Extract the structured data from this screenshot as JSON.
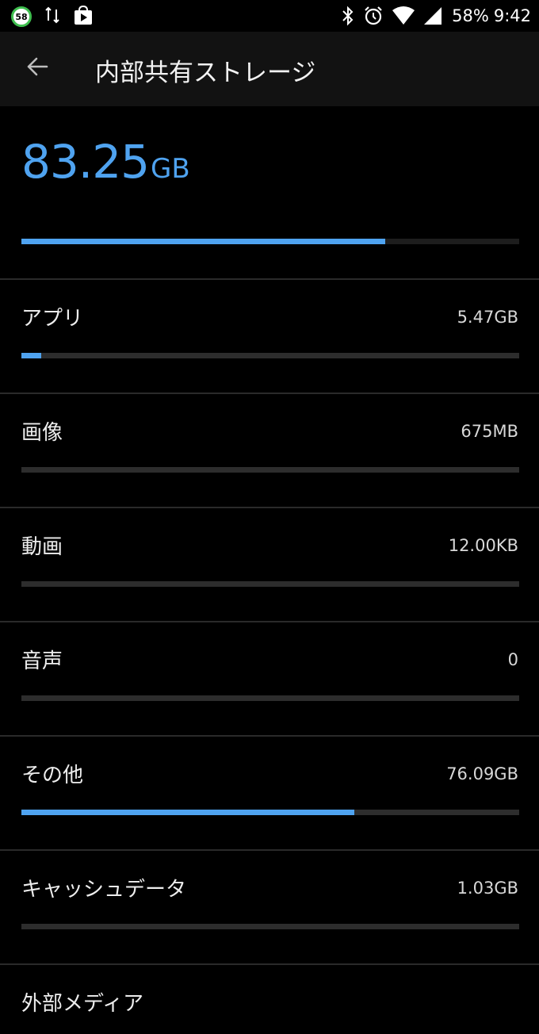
{
  "status_bar": {
    "badge": "58",
    "battery": "58%",
    "time": "9:42"
  },
  "header": {
    "title": "内部共有ストレージ"
  },
  "summary": {
    "total_value": "83.25",
    "total_unit": "GB",
    "used_fraction": 0.731
  },
  "categories": [
    {
      "label": "アプリ",
      "size": "5.47GB",
      "fraction": 0.04
    },
    {
      "label": "画像",
      "size": "675MB",
      "fraction": 0.0
    },
    {
      "label": "動画",
      "size": "12.00KB",
      "fraction": 0.0
    },
    {
      "label": "音声",
      "size": "0",
      "fraction": 0.0
    },
    {
      "label": "その他",
      "size": "76.09GB",
      "fraction": 0.669
    },
    {
      "label": "キャッシュデータ",
      "size": "1.03GB",
      "fraction": 0.0
    }
  ],
  "external": {
    "label": "外部メディア"
  },
  "colors": {
    "accent": "#4fa3f0",
    "track": "#2d2d2d",
    "background": "#000000",
    "app_bar": "#121212"
  }
}
